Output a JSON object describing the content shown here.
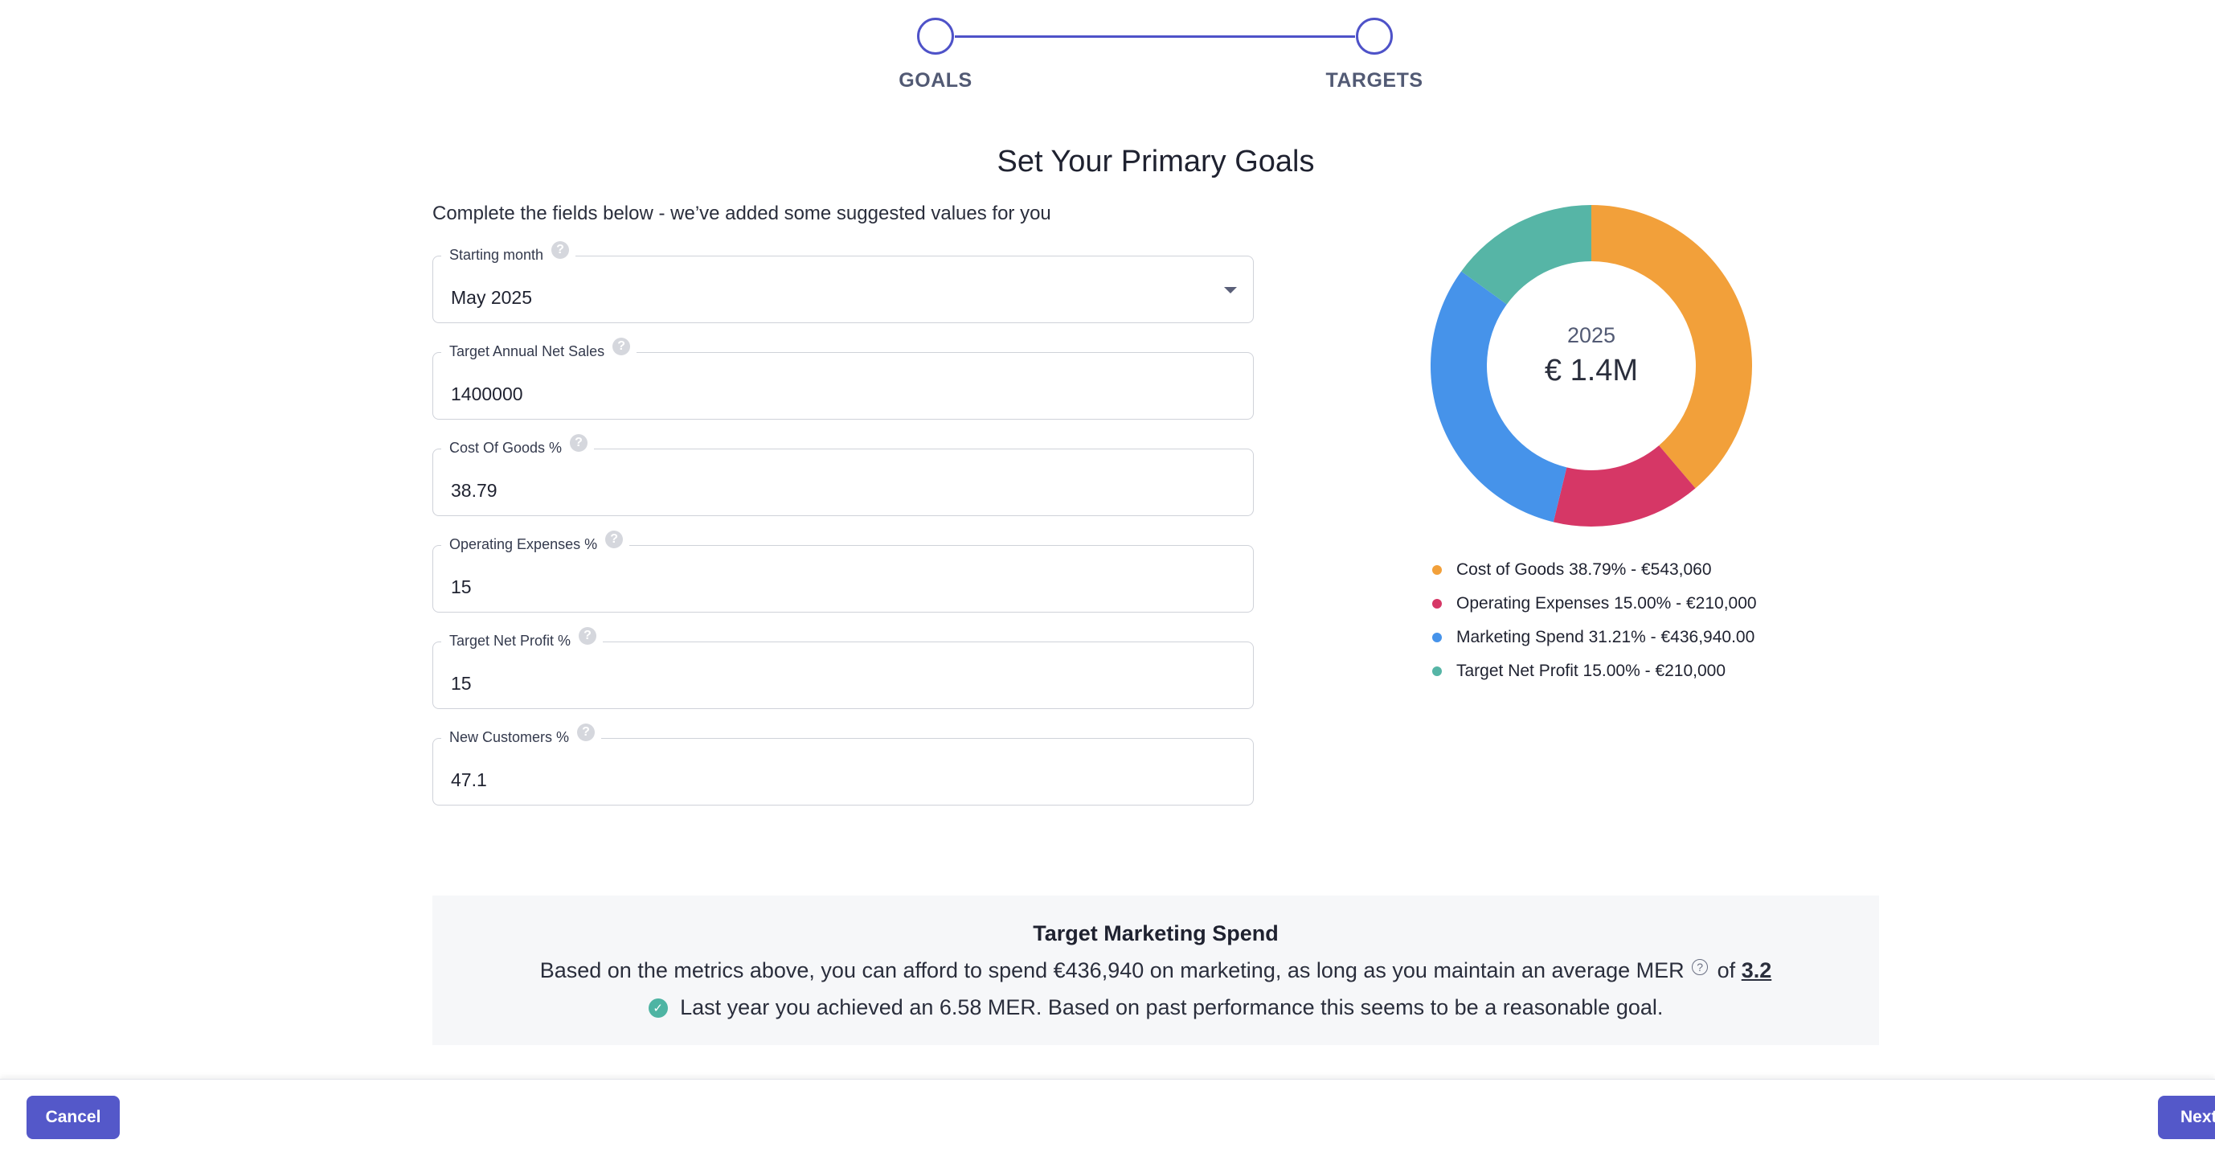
{
  "stepper": {
    "steps": [
      {
        "label": "GOALS"
      },
      {
        "label": "TARGETS"
      }
    ]
  },
  "page": {
    "title": "Set Your Primary Goals",
    "intro": "Complete the fields below - we’ve added some suggested values for you"
  },
  "fields": {
    "starting_month": {
      "label": "Starting month",
      "value": "May 2025"
    },
    "net_sales": {
      "label": "Target Annual Net Sales",
      "value": "1400000"
    },
    "cost_of_goods": {
      "label": "Cost Of Goods %",
      "value": "38.79"
    },
    "operating_expenses": {
      "label": "Operating Expenses %",
      "value": "15"
    },
    "net_profit": {
      "label": "Target Net Profit %",
      "value": "15"
    },
    "new_customers": {
      "label": "New Customers %",
      "value": "47.1"
    }
  },
  "help_icon_glyph": "?",
  "chart_data": {
    "type": "pie",
    "donut": true,
    "center_year": "2025",
    "center_total": "€ 1.4M",
    "slices": [
      {
        "label": "Cost of Goods 38.79% - €543,060",
        "value": 38.79,
        "color": "#f2a03a"
      },
      {
        "label": "Operating Expenses 15.00% - €210,000",
        "value": 15.0,
        "color": "#d63766"
      },
      {
        "label": "Marketing Spend 31.21% - €436,940.00",
        "value": 31.21,
        "color": "#4693ea"
      },
      {
        "label": "Target Net Profit 15.00% - €210,000",
        "value": 15.0,
        "color": "#56b5a6"
      }
    ]
  },
  "summary": {
    "title": "Target Marketing Spend",
    "line1_text": "Based on the metrics above, you can afford to spend €436,940 on marketing, as long as you maintain an average MER",
    "mer_help_glyph": "?",
    "line1_of": "of",
    "mer_value": "3.2",
    "check_glyph": "✓",
    "line2_text": "Last year you achieved an 6.58 MER. Based on past performance this seems to be a reasonable goal."
  },
  "footer": {
    "cancel_label": "Cancel",
    "next_label": "Next"
  }
}
